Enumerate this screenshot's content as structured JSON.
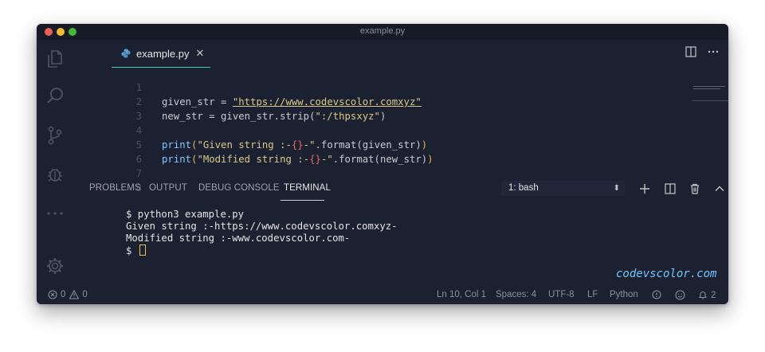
{
  "window": {
    "title": "example.py"
  },
  "tab": {
    "label": "example.py",
    "close": "✕"
  },
  "code": {
    "lines": [
      {
        "num": "1",
        "var": "given_str",
        "eq": " = ",
        "str": "\"https://www.codevscolor.comxyz\""
      },
      {
        "num": "2",
        "a": "new_str = given_str.strip(",
        "str": "\":/thpsxyz\"",
        "b": ")"
      },
      {
        "num": "3"
      },
      {
        "num": "4",
        "fn": "print",
        "p1": "(",
        "s1": "\"Given string :-",
        "br": "{}",
        "s2": "-\"",
        "mid": ".format(given_str)",
        "p2": ")"
      },
      {
        "num": "5",
        "fn": "print",
        "p1": "(",
        "s1": "\"Modified string :-",
        "br": "{}",
        "s2": "-\"",
        "mid": ".format(new_str)",
        "p2": ")"
      },
      {
        "num": "6"
      },
      {
        "num": "7"
      },
      {
        "num": "8"
      }
    ]
  },
  "panel": {
    "tabs": [
      "PROBLEMS",
      "OUTPUT",
      "DEBUG CONSOLE",
      "TERMINAL"
    ],
    "terminal_select": "1: bash",
    "select_arrow": "⬍"
  },
  "terminal": {
    "lines": [
      "$ python3 example.py",
      "Given string :-https://www.codevscolor.comxyz-",
      "Modified string :-www.codevscolor.com-"
    ],
    "prompt": "$ "
  },
  "watermark": "codevscolor.com",
  "status": {
    "errors": "0",
    "warnings": "0",
    "position": "Ln 10, Col 1",
    "spaces": "Spaces: 4",
    "encoding": "UTF-8",
    "eol": "LF",
    "language": "Python",
    "notifications": "2"
  },
  "colors": {
    "window_bg": "#1b2130",
    "accent_tab": "#4ec9b0",
    "string": "#d9c987",
    "function": "#7fc7ff",
    "brace": "#e46a6a",
    "cursor": "#e8c34a"
  },
  "icons": [
    "files-icon",
    "search-icon",
    "source-control-icon",
    "debug-icon",
    "more-icon",
    "settings-icon",
    "python-file-icon",
    "split-editor-icon",
    "more-actions-icon",
    "plus-icon",
    "split-terminal-icon",
    "trash-icon",
    "chevron-up-icon",
    "close-icon",
    "error-icon",
    "warning-icon",
    "feedback-icon",
    "smiley-icon",
    "bell-icon"
  ]
}
